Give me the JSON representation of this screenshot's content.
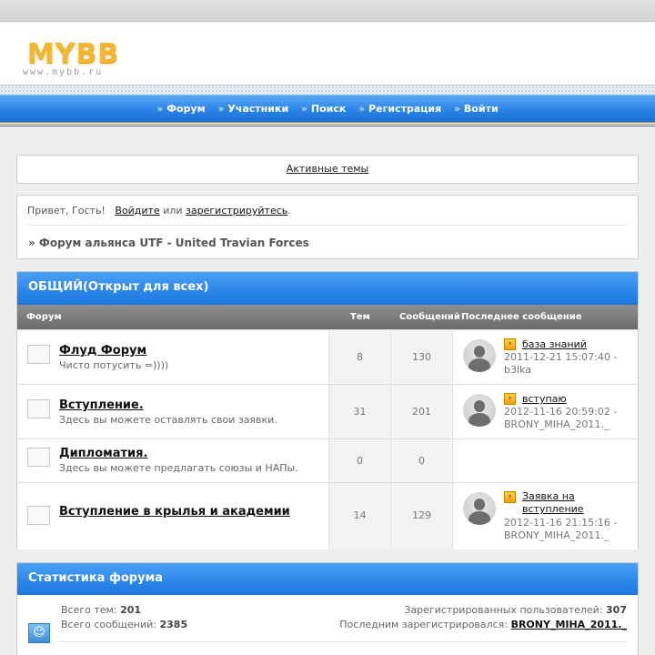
{
  "header": {
    "logo": "MYBB",
    "logo_sub": "www.mybb.ru"
  },
  "nav": [
    {
      "label": "Форум"
    },
    {
      "label": "Участники"
    },
    {
      "label": "Поиск"
    },
    {
      "label": "Регистрация"
    },
    {
      "label": "Войти"
    }
  ],
  "active_topics": "Активные темы",
  "welcome": {
    "greeting": "Привет, Гость!",
    "login": "Войдите",
    "or": "или",
    "register": "зарегистрируйтесь",
    "period": ".",
    "crumb": "» Форум альянса UTF - United Travian Forces"
  },
  "category": {
    "title": "ОБЩИЙ(Открыт для всех)",
    "columns": {
      "forum": "Форум",
      "topics": "Тем",
      "posts": "Сообщений",
      "last": "Последнее сообщение"
    },
    "forums": [
      {
        "name": "Флуд Форум",
        "desc": "Чисто потусить =))))",
        "topics": "8",
        "posts": "130",
        "last_title": "база знаний",
        "last_date": "2011-12-21 15:07:40 -",
        "last_user": "b3lka"
      },
      {
        "name": "Вступление.",
        "desc": "Здесь вы можете оставлять свои заявки.",
        "topics": "31",
        "posts": "201",
        "last_title": "вступаю",
        "last_date": "2012-11-16 20:59:02 -",
        "last_user": "BRONY_MIHA_2011._"
      },
      {
        "name": "Дипломатия.",
        "desc": "Здесь вы можете предлагать союзы и НАПы.",
        "topics": "0",
        "posts": "0",
        "last_title": "",
        "last_date": "",
        "last_user": ""
      },
      {
        "name": "Вступление в крылья и академии",
        "desc": "",
        "topics": "14",
        "posts": "129",
        "last_title": "Заявка на вступление",
        "last_date": "2012-11-16 21:15:16 -",
        "last_user": "BRONY_MIHA_2011._"
      }
    ]
  },
  "stats": {
    "title": "Статистика форума",
    "topics_label": "Всего тем:",
    "topics": "201",
    "posts_label": "Всего сообщений:",
    "posts": "2385",
    "users_label": "Зарегистрированных пользователей:",
    "users": "307",
    "last_reg_label": "Последним зарегистрировался:",
    "last_reg": "BRONY_MIHA_2011._"
  },
  "icons": {
    "nav_marker": "»",
    "new_post": "go-to-post-icon",
    "stats": "users-icon"
  },
  "colors": {
    "accent": "#2b86ea",
    "logo": "#f2b632",
    "col_head": "#7a7a7a"
  }
}
